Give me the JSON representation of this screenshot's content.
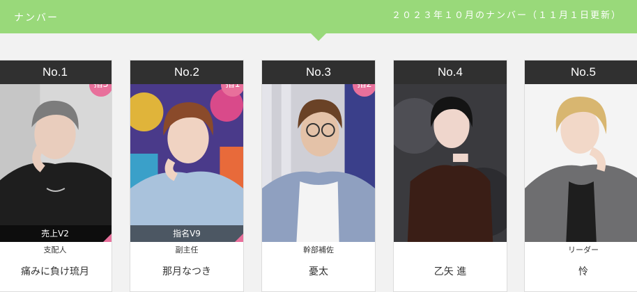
{
  "header": {
    "section_title": "ナンバー",
    "date_title": "２０２３年１０月のナンバー（１１月１日更新）"
  },
  "ranking": [
    {
      "rank": "No.1",
      "badge": "指3",
      "tag": "売上V2",
      "role": "支配人",
      "name": "痛みに負け琉月"
    },
    {
      "rank": "No.2",
      "badge": "指1",
      "tag": "指名V9",
      "role": "副主任",
      "name": "那月なつき"
    },
    {
      "rank": "No.3",
      "badge": "指2",
      "tag": "",
      "role": "幹部補佐",
      "name": "憂太"
    },
    {
      "rank": "No.4",
      "badge": "",
      "tag": "",
      "role": "",
      "name": "乙矢 進"
    },
    {
      "rank": "No.5",
      "badge": "",
      "tag": "",
      "role": "リーダー",
      "name": "怜"
    }
  ],
  "colors": {
    "header_green": "#99d97a",
    "badge_pink": "#e8709b",
    "rank_bar": "#303030"
  }
}
